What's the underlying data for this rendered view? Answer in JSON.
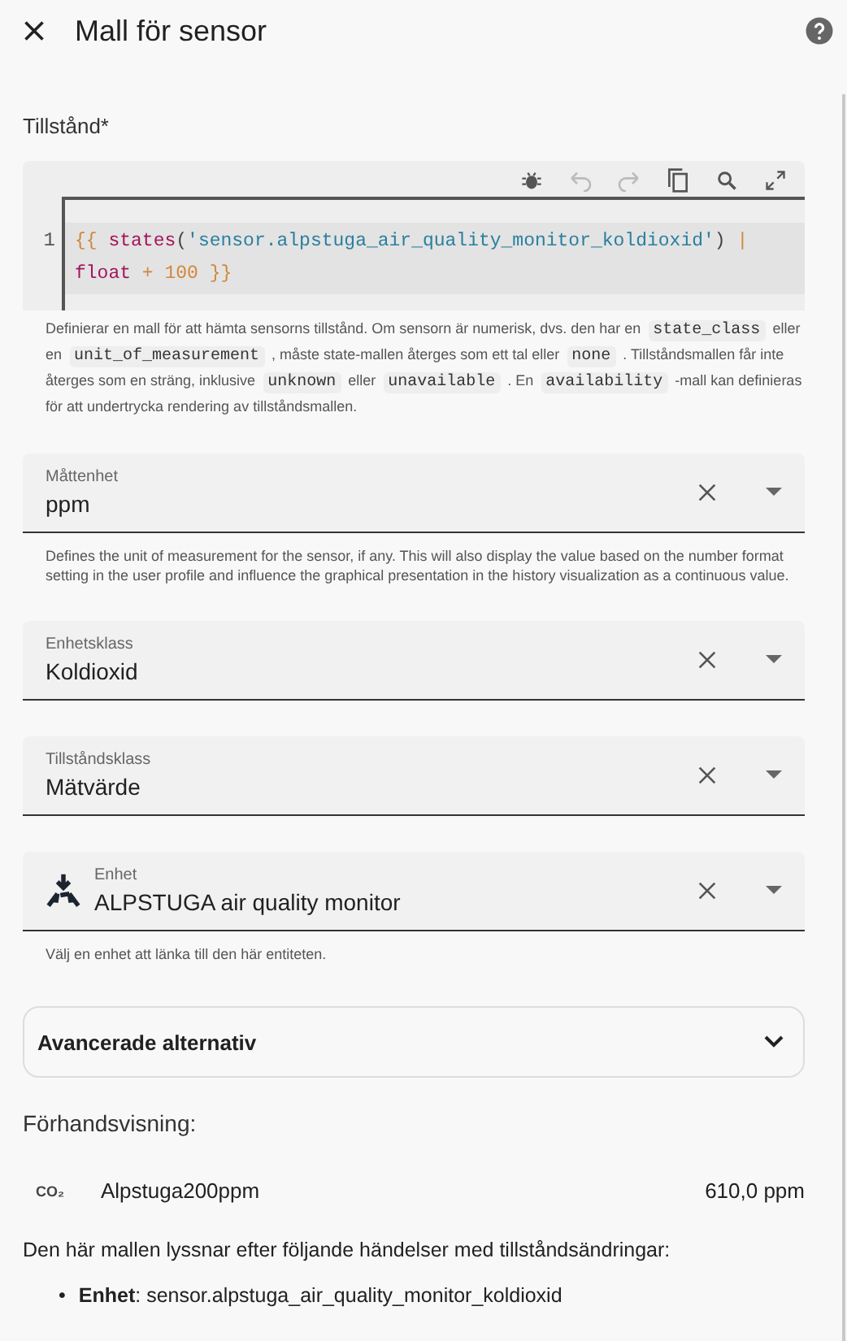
{
  "dialog": {
    "title": "Mall för sensor"
  },
  "state_template": {
    "label": "Tillstånd*",
    "line_number": "1",
    "code": [
      {
        "kind": "punct",
        "text": "{{ "
      },
      {
        "kind": "func",
        "text": "states"
      },
      {
        "kind": "plain",
        "text": "("
      },
      {
        "kind": "string",
        "text": "'sensor.alpstuga_air_quality_monitor_koldioxid'"
      },
      {
        "kind": "plain",
        "text": ") "
      },
      {
        "kind": "punct",
        "text": "|"
      },
      {
        "kind": "func",
        "text": " float"
      },
      {
        "kind": "punct",
        "text": " + 100 }}"
      }
    ],
    "helper": [
      {
        "kind": "text",
        "text": "Definierar en mall för att hämta sensorns tillstånd. Om sensorn är numerisk, dvs. den har en"
      },
      {
        "kind": "code",
        "text": "state_class"
      },
      {
        "kind": "text",
        "text": "eller en"
      },
      {
        "kind": "code",
        "text": "unit_of_measurement"
      },
      {
        "kind": "text",
        "text": ", måste state-mallen återges som ett tal eller"
      },
      {
        "kind": "code",
        "text": "none"
      },
      {
        "kind": "text",
        "text": ". Tillståndsmallen får inte återges som en sträng, inklusive"
      },
      {
        "kind": "code",
        "text": "unknown"
      },
      {
        "kind": "text",
        "text": "eller"
      },
      {
        "kind": "code",
        "text": "unavailable"
      },
      {
        "kind": "text",
        "text": ". En"
      },
      {
        "kind": "code",
        "text": "availability"
      },
      {
        "kind": "text",
        "text": "-mall kan definieras för att undertrycka rendering av tillståndsmallen."
      }
    ]
  },
  "fields": [
    {
      "label": "Måttenhet",
      "value": "ppm",
      "helper": "Defines the unit of measurement for the sensor, if any. This will also display the value based on the number format setting in the user profile and influence the graphical presentation in the history visualization as a continuous value.",
      "has_icon": false
    },
    {
      "label": "Enhetsklass",
      "value": "Koldioxid",
      "has_icon": false
    },
    {
      "label": "Tillståndsklass",
      "value": "Mätvärde",
      "has_icon": false
    },
    {
      "label": "Enhet",
      "value": "ALPSTUGA air quality monitor",
      "helper": "Välj en enhet att länka till den här entiteten.",
      "has_icon": true
    }
  ],
  "advanced": {
    "label": "Avancerade alternativ",
    "expanded": false
  },
  "preview": {
    "heading": "Förhandsvisning:",
    "icon_text": "CO₂",
    "name": "Alpstuga200ppm",
    "value": "610,0 ppm"
  },
  "listeners": {
    "intro": "Den här mallen lyssnar efter följande händelser med tillståndsändringar:",
    "items": [
      {
        "marker": "•",
        "text": "**Enhet**: sensor.alpstuga_air_quality_monitor_koldioxid"
      }
    ]
  }
}
